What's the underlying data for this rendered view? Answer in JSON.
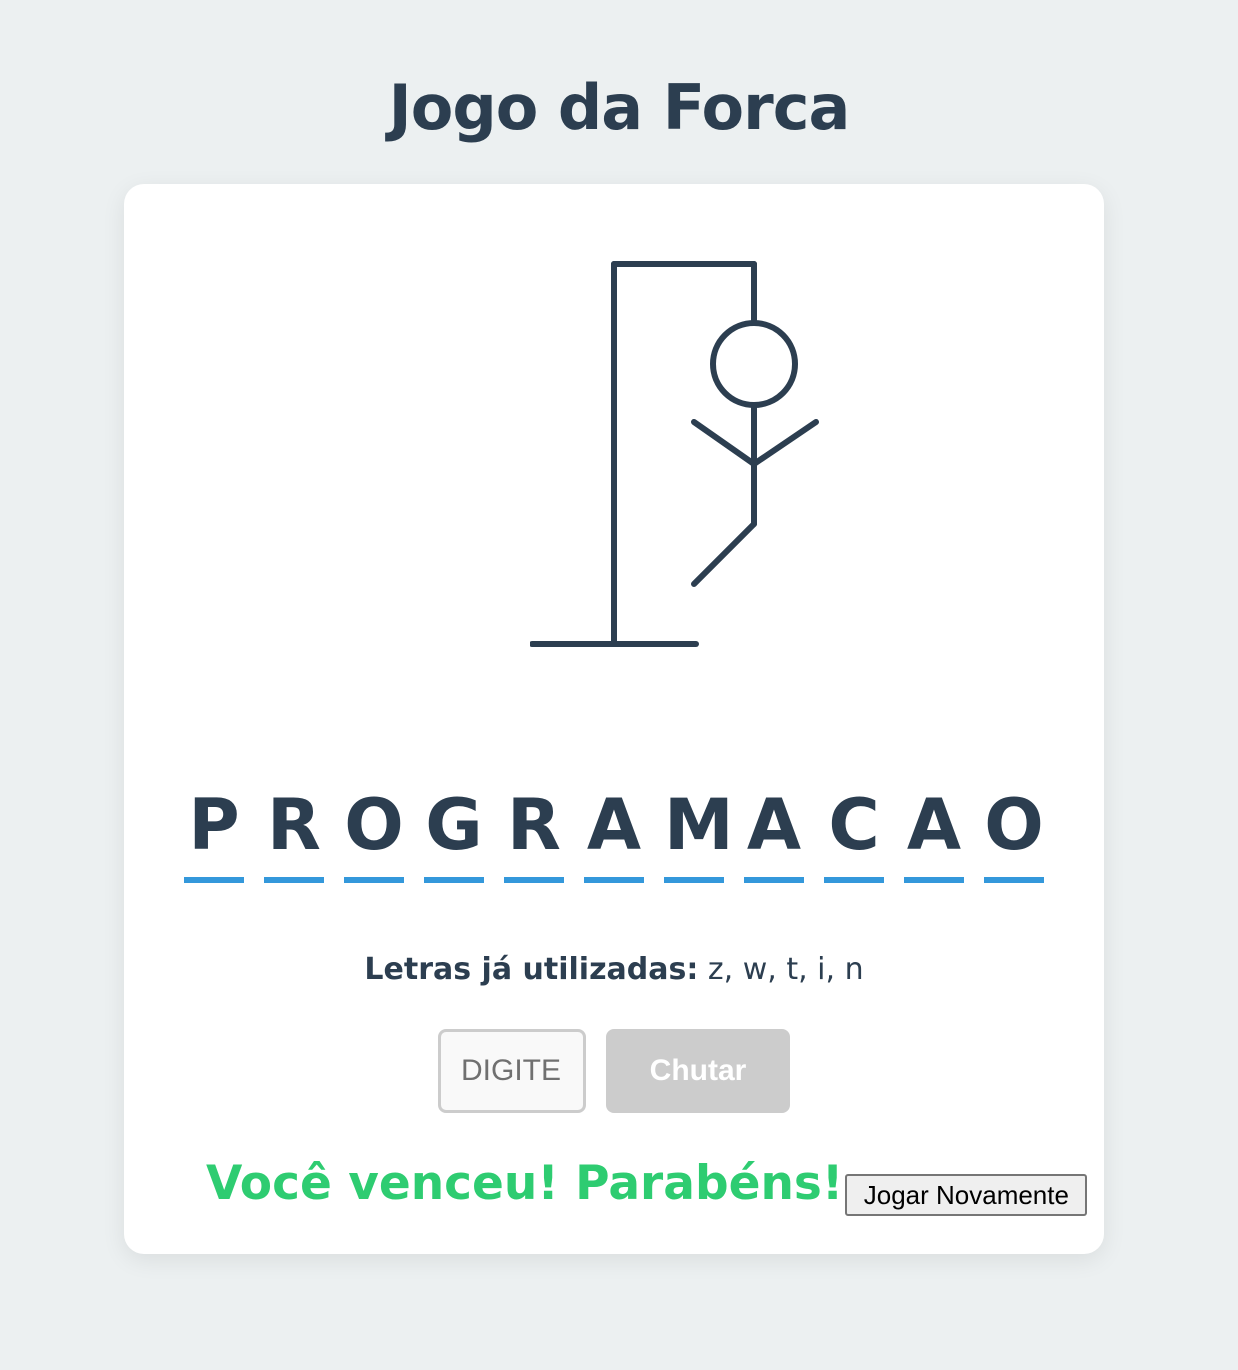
{
  "page": {
    "title": "Jogo da Forca"
  },
  "game": {
    "word_letters": [
      "P",
      "R",
      "O",
      "G",
      "R",
      "A",
      "M",
      "A",
      "C",
      "A",
      "O"
    ],
    "used_letters_label": "Letras já utilizadas:",
    "used_letters_value": " z, w, t, i, n",
    "input_placeholder": "DIGITE",
    "guess_button_label": "Chutar",
    "result_message": "Você venceu! Parabéns!",
    "play_again_label": "Jogar Novamente"
  },
  "colors": {
    "background": "#ecf0f1",
    "text": "#2c3e50",
    "underline": "#3498db",
    "success": "#2ecc71",
    "disabled_button": "#cccccc"
  }
}
